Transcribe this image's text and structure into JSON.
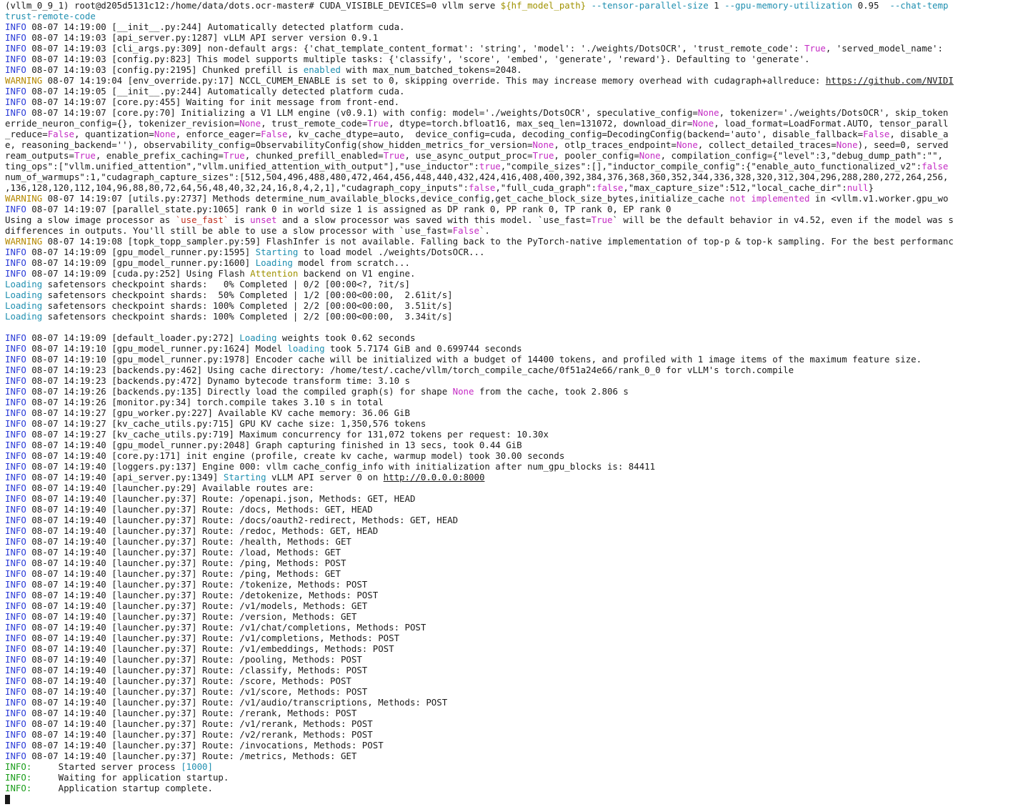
{
  "prompt_lines": [
    "(vllm_0_9_1) root@d205d5131c12:/home/data/dots.ocr-master# CUDA_VISIBLE_DEVICES=0 vllm serve ${hf_model_path} --tensor-parallel-size 1 --gpu-memory-utilization 0.95  --chat-temp",
    "trust-remote-code"
  ],
  "log": {
    "l01": "INFO 08-07 14:19:00 [__init__.py:244] Automatically detected platform cuda.",
    "l02": "INFO 08-07 14:19:03 [api_server.py:1287] vLLM API server version 0.9.1",
    "l03": "INFO 08-07 14:19:03 [cli_args.py:309] non-default args: {'chat_template_content_format': 'string', 'model': './weights/DotsOCR', 'trust_remote_code': True, 'served_model_name':",
    "l04": "INFO 08-07 14:19:03 [config.py:823] This model supports multiple tasks: {'classify', 'score', 'embed', 'generate', 'reward'}. Defaulting to 'generate'.",
    "l05": "INFO 08-07 14:19:03 [config.py:2195] Chunked prefill is enabled with max_num_batched_tokens=2048.",
    "l06": "WARNING 08-07 14:19:04 [env_override.py:17] NCCL_CUMEM_ENABLE is set to 0, skipping override. This may increase memory overhead with cudagraph+allreduce: https://github.com/NVIDI",
    "l07": "INFO 08-07 14:19:05 [__init__.py:244] Automatically detected platform cuda.",
    "l08": "INFO 08-07 14:19:07 [core.py:455] Waiting for init message from front-end.",
    "l09": "INFO 08-07 14:19:07 [core.py:70] Initializing a V1 LLM engine (v0.9.1) with config: model='./weights/DotsOCR', speculative_config=None, tokenizer='./weights/DotsOCR', skip_token",
    "l10": "erride_neuron_config={}, tokenizer_revision=None, trust_remote_code=True, dtype=torch.bfloat16, max_seq_len=131072, download_dir=None, load_format=LoadFormat.AUTO, tensor_parall",
    "l11": "_reduce=False, quantization=None, enforce_eager=False, kv_cache_dtype=auto,  device_config=cuda, decoding_config=DecodingConfig(backend='auto', disable_fallback=False, disable_a",
    "l12": "e, reasoning_backend=''), observability_config=ObservabilityConfig(show_hidden_metrics_for_version=None, otlp_traces_endpoint=None, collect_detailed_traces=None), seed=0, served",
    "l13": "ream_outputs=True, enable_prefix_caching=True, chunked_prefill_enabled=True, use_async_output_proc=True, pooler_config=None, compilation_config={\"level\":3,\"debug_dump_path\":\"\",",
    "l14": "ting_ops\":[\"vllm.unified_attention\",\"vllm.unified_attention_with_output\"],\"use_inductor\":true,\"compile_sizes\":[],\"inductor_compile_config\":{\"enable_auto_functionalized_v2\":false",
    "l15": "num_of_warmups\":1,\"cudagraph_capture_sizes\":[512,504,496,488,480,472,464,456,448,440,432,424,416,408,400,392,384,376,368,360,352,344,336,328,320,312,304,296,288,280,272,264,256,",
    "l16": ",136,128,120,112,104,96,88,80,72,64,56,48,40,32,24,16,8,4,2,1],\"cudagraph_copy_inputs\":false,\"full_cuda_graph\":false,\"max_capture_size\":512,\"local_cache_dir\":null}",
    "l17": "WARNING 08-07 14:19:07 [utils.py:2737] Methods determine_num_available_blocks,device_config,get_cache_block_size_bytes,initialize_cache not implemented in <vllm.v1.worker.gpu_wo",
    "l18": "INFO 08-07 14:19:07 [parallel_state.py:1065] rank 0 in world size 1 is assigned as DP rank 0, PP rank 0, TP rank 0, EP rank 0",
    "l19": "Using a slow image processor as `use_fast` is unset and a slow processor was saved with this model. `use_fast=True` will be the default behavior in v4.52, even if the model was s",
    "l20": "differences in outputs. You'll still be able to use a slow processor with `use_fast=False`.",
    "l21": "WARNING 08-07 14:19:08 [topk_topp_sampler.py:59] FlashInfer is not available. Falling back to the PyTorch-native implementation of top-p & top-k sampling. For the best performanc",
    "l22": "INFO 08-07 14:19:09 [gpu_model_runner.py:1595] Starting to load model ./weights/DotsOCR...",
    "l23": "INFO 08-07 14:19:09 [gpu_model_runner.py:1600] Loading model from scratch...",
    "l24": "INFO 08-07 14:19:09 [cuda.py:252] Using Flash Attention backend on V1 engine.",
    "l25": "Loading safetensors checkpoint shards:   0% Completed | 0/2 [00:00<?, ?it/s]",
    "l26": "Loading safetensors checkpoint shards:  50% Completed | 1/2 [00:00<00:00,  2.61it/s]",
    "l27": "Loading safetensors checkpoint shards: 100% Completed | 2/2 [00:00<00:00,  3.51it/s]",
    "l28": "Loading safetensors checkpoint shards: 100% Completed | 2/2 [00:00<00:00,  3.34it/s]",
    "l29": "INFO 08-07 14:19:09 [default_loader.py:272] Loading weights took 0.62 seconds",
    "l30": "INFO 08-07 14:19:10 [gpu_model_runner.py:1624] Model loading took 5.7174 GiB and 0.699744 seconds",
    "l31": "INFO 08-07 14:19:10 [gpu_model_runner.py:1978] Encoder cache will be initialized with a budget of 14400 tokens, and profiled with 1 image items of the maximum feature size.",
    "l32": "INFO 08-07 14:19:23 [backends.py:462] Using cache directory: /home/test/.cache/vllm/torch_compile_cache/0f51a24e66/rank_0_0 for vLLM's torch.compile",
    "l33": "INFO 08-07 14:19:23 [backends.py:472] Dynamo bytecode transform time: 3.10 s",
    "l34": "INFO 08-07 14:19:26 [backends.py:135] Directly load the compiled graph(s) for shape None from the cache, took 2.806 s",
    "l35": "INFO 08-07 14:19:26 [monitor.py:34] torch.compile takes 3.10 s in total",
    "l36": "INFO 08-07 14:19:27 [gpu_worker.py:227] Available KV cache memory: 36.06 GiB",
    "l37": "INFO 08-07 14:19:27 [kv_cache_utils.py:715] GPU KV cache size: 1,350,576 tokens",
    "l38": "INFO 08-07 14:19:27 [kv_cache_utils.py:719] Maximum concurrency for 131,072 tokens per request: 10.30x",
    "l39": "INFO 08-07 14:19:40 [gpu_model_runner.py:2048] Graph capturing finished in 13 secs, took 0.44 GiB",
    "l40": "INFO 08-07 14:19:40 [core.py:171] init engine (profile, create kv cache, warmup model) took 30.00 seconds",
    "l41": "INFO 08-07 14:19:40 [loggers.py:137] Engine 000: vllm cache_config_info with initialization after num_gpu_blocks is: 84411",
    "l42": "INFO 08-07 14:19:40 [api_server.py:1349] Starting vLLM API server 0 on http://0.0.0.0:8000",
    "l43": "INFO 08-07 14:19:40 [launcher.py:29] Available routes are:"
  },
  "routes": [
    "/openapi.json, Methods: GET, HEAD",
    "/docs, Methods: GET, HEAD",
    "/docs/oauth2-redirect, Methods: GET, HEAD",
    "/redoc, Methods: GET, HEAD",
    "/health, Methods: GET",
    "/load, Methods: GET",
    "/ping, Methods: POST",
    "/ping, Methods: GET",
    "/tokenize, Methods: POST",
    "/detokenize, Methods: POST",
    "/v1/models, Methods: GET",
    "/version, Methods: GET",
    "/v1/chat/completions, Methods: POST",
    "/v1/completions, Methods: POST",
    "/v1/embeddings, Methods: POST",
    "/pooling, Methods: POST",
    "/classify, Methods: POST",
    "/score, Methods: POST",
    "/v1/score, Methods: POST",
    "/v1/audio/transcriptions, Methods: POST",
    "/rerank, Methods: POST",
    "/v1/rerank, Methods: POST",
    "/v2/rerank, Methods: POST",
    "/invocations, Methods: POST",
    "/metrics, Methods: GET"
  ],
  "route_prefix": "INFO 08-07 14:19:40 [launcher.py:37] Route: ",
  "uvicorn": [
    {
      "level": "INFO:",
      "text": "     Started server process [1000]"
    },
    {
      "level": "INFO:",
      "text": "     Waiting for application startup."
    },
    {
      "level": "INFO:",
      "text": "     Application startup complete."
    }
  ],
  "colors": {
    "info": "#2a3bd8",
    "warning": "#b58900",
    "green": "#1a9d1a",
    "magenta": "#c42bc4",
    "cyan": "#1f8fb0",
    "red": "#d02020"
  }
}
